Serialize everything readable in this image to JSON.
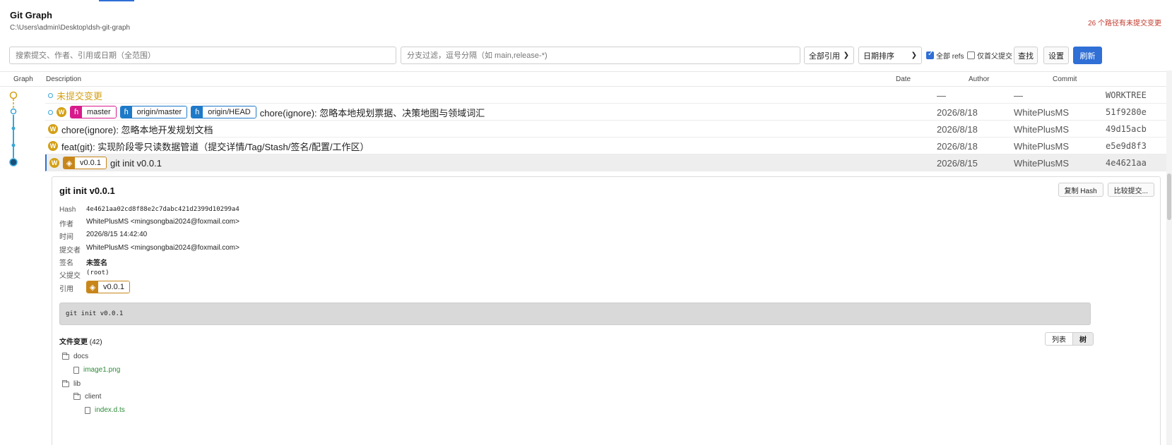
{
  "header": {
    "title": "Git Graph",
    "path": "C:\\Users\\admin\\Desktop\\dsh-git-graph",
    "uncommitted_warning": "26 个路径有未提交变更"
  },
  "toolbar": {
    "search_placeholder": "搜索提交、作者、引用或日期（全范围）",
    "branch_filter_placeholder": "分支过滤，逗号分隔（如 main,release-*)",
    "refs_select": "全部引用",
    "sort_select": "日期排序",
    "all_refs_label": "全部 refs",
    "first_parent_label": "仅首父提交",
    "find_label": "查找",
    "settings_label": "设置",
    "refresh_label": "刷新"
  },
  "columns": {
    "graph": "Graph",
    "description": "Description",
    "date": "Date",
    "author": "Author",
    "commit": "Commit"
  },
  "commits": [
    {
      "description": "未提交变更",
      "date": "—",
      "author": "—",
      "hash": "WORKTREE"
    },
    {
      "avatar": "W",
      "refs": [
        "master",
        "origin/master",
        "origin/HEAD"
      ],
      "description": "chore(ignore): 忽略本地规划票据、决策地图与领域词汇",
      "date": "2026/8/18",
      "author": "WhitePlusMS",
      "hash": "51f9280e"
    },
    {
      "avatar": "W",
      "description": "chore(ignore): 忽略本地开发规划文档",
      "date": "2026/8/18",
      "author": "WhitePlusMS",
      "hash": "49d15acb"
    },
    {
      "avatar": "W",
      "description": "feat(git): 实现阶段零只读数据管道（提交详情/Tag/Stash/签名/配置/工作区）",
      "date": "2026/8/18",
      "author": "WhitePlusMS",
      "hash": "e5e9d8f3"
    },
    {
      "avatar": "W",
      "refs": [
        "v0.0.1"
      ],
      "description": "git init v0.0.1",
      "date": "2026/8/15",
      "author": "WhitePlusMS",
      "hash": "4e4621aa"
    }
  ],
  "detail": {
    "title": "git init v0.0.1",
    "copy_hash_label": "复制 Hash",
    "compare_label": "比较提交...",
    "labels": {
      "hash": "Hash",
      "author": "作者",
      "time": "时间",
      "committer": "提交者",
      "signature": "签名",
      "parent": "父提交",
      "refs": "引用"
    },
    "hash": "4e4621aa02cd8f88e2c7dabc421d2399d10299a4",
    "author": "WhitePlusMS <mingsongbai2024@foxmail.com>",
    "time": "2026/8/15 14:42:40",
    "committer": "WhitePlusMS <mingsongbai2024@foxmail.com>",
    "signature": "未签名",
    "parent": "(root)",
    "ref": "v0.0.1",
    "message": "git init v0.0.1",
    "files_title": "文件变更",
    "files_count": "(42)",
    "view_list": "列表",
    "view_tree": "树",
    "tree": [
      {
        "name": "docs",
        "type": "folder"
      },
      {
        "name": "image1.png",
        "type": "file"
      },
      {
        "name": "lib",
        "type": "folder"
      },
      {
        "name": "client",
        "type": "folder"
      },
      {
        "name": "index.d.ts",
        "type": "file"
      }
    ]
  },
  "colors": {
    "accent": "#2f6fd6",
    "graph_line": "#3aa6d6",
    "uncommitted": "#d4a017",
    "warning": "#c0392b",
    "file_green": "#2e8b3a"
  }
}
